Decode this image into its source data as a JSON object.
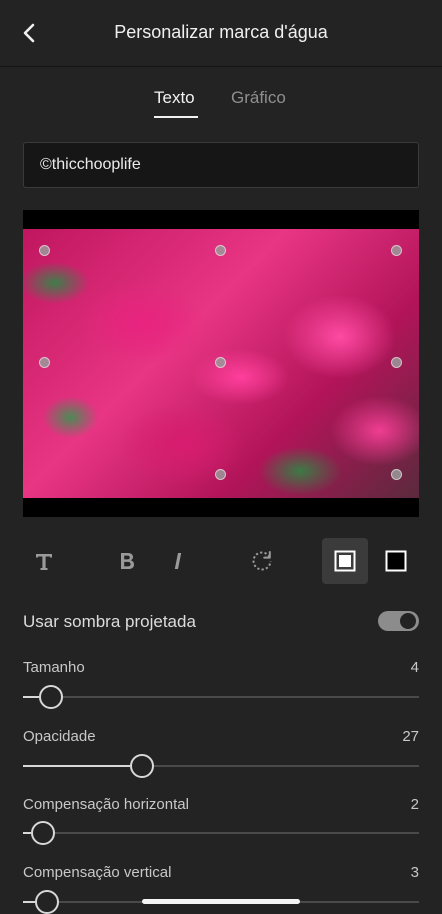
{
  "header": {
    "title": "Personalizar marca d'água"
  },
  "tabs": [
    {
      "label": "Texto"
    },
    {
      "label": "Gráfico"
    }
  ],
  "text_field": {
    "value": "©thicchooplife"
  },
  "toolbar": {
    "icons": [
      "text-style-icon",
      "bold-icon",
      "italic-icon",
      "rotate-icon",
      "filled-box-icon",
      "outline-box-icon"
    ]
  },
  "shadow": {
    "label": "Usar sombra projetada",
    "enabled": true
  },
  "sliders": [
    {
      "label": "Tamanho",
      "value": "4",
      "level": 0.04
    },
    {
      "label": "Opacidade",
      "value": "27",
      "level": 0.27
    },
    {
      "label": "Compensação horizontal",
      "value": "2",
      "level": 0.02
    },
    {
      "label": "Compensação vertical",
      "value": "3",
      "level": 0.03
    }
  ]
}
